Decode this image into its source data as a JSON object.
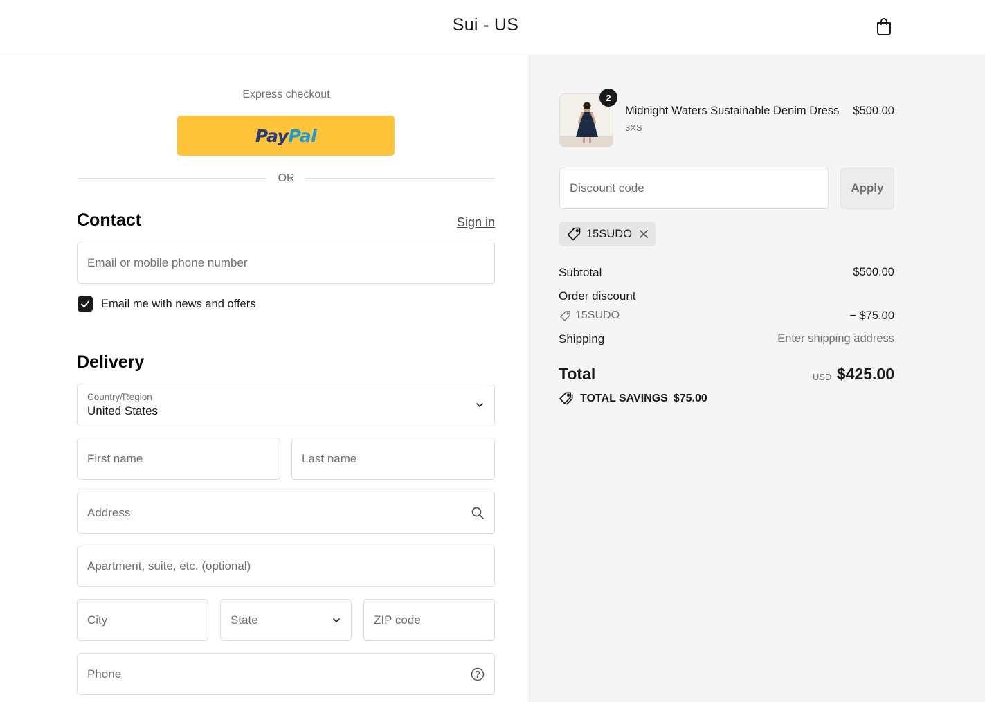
{
  "header": {
    "store_title": "Sui - US",
    "cart_icon": "shopping-bag-icon"
  },
  "express": {
    "label": "Express checkout",
    "paypal_pay": "Pay",
    "paypal_pal": "Pal",
    "or": "OR"
  },
  "contact": {
    "heading": "Contact",
    "sign_in": "Sign in",
    "email_placeholder": "Email or mobile phone number",
    "newsletter_label": "Email me with news and offers",
    "newsletter_checked": true
  },
  "delivery": {
    "heading": "Delivery",
    "country_label": "Country/Region",
    "country_value": "United States",
    "first_name_placeholder": "First name",
    "last_name_placeholder": "Last name",
    "address_placeholder": "Address",
    "apartment_placeholder": "Apartment, suite, etc. (optional)",
    "city_placeholder": "City",
    "state_placeholder": "State",
    "zip_placeholder": "ZIP code",
    "phone_placeholder": "Phone"
  },
  "order": {
    "item": {
      "quantity": "2",
      "name": "Midnight Waters Sustainable Denim Dress",
      "variant": "3XS",
      "price": "$500.00"
    },
    "discount_placeholder": "Discount code",
    "apply_label": "Apply",
    "applied_code": "15SUDO",
    "subtotal_label": "Subtotal",
    "subtotal_value": "$500.00",
    "order_discount_label": "Order discount",
    "discount_code": "15SUDO",
    "discount_value": "− $75.00",
    "shipping_label": "Shipping",
    "shipping_value": "Enter shipping address",
    "total_label": "Total",
    "total_currency": "USD",
    "total_value": "$425.00",
    "savings_label": "TOTAL SAVINGS",
    "savings_value": "$75.00"
  },
  "colors": {
    "paypal_yellow": "#ffc439",
    "paypal_navy": "#253b80",
    "paypal_blue": "#179bd7",
    "summary_bg": "#f5f5f5",
    "checkbox": "#1a1a1a"
  }
}
